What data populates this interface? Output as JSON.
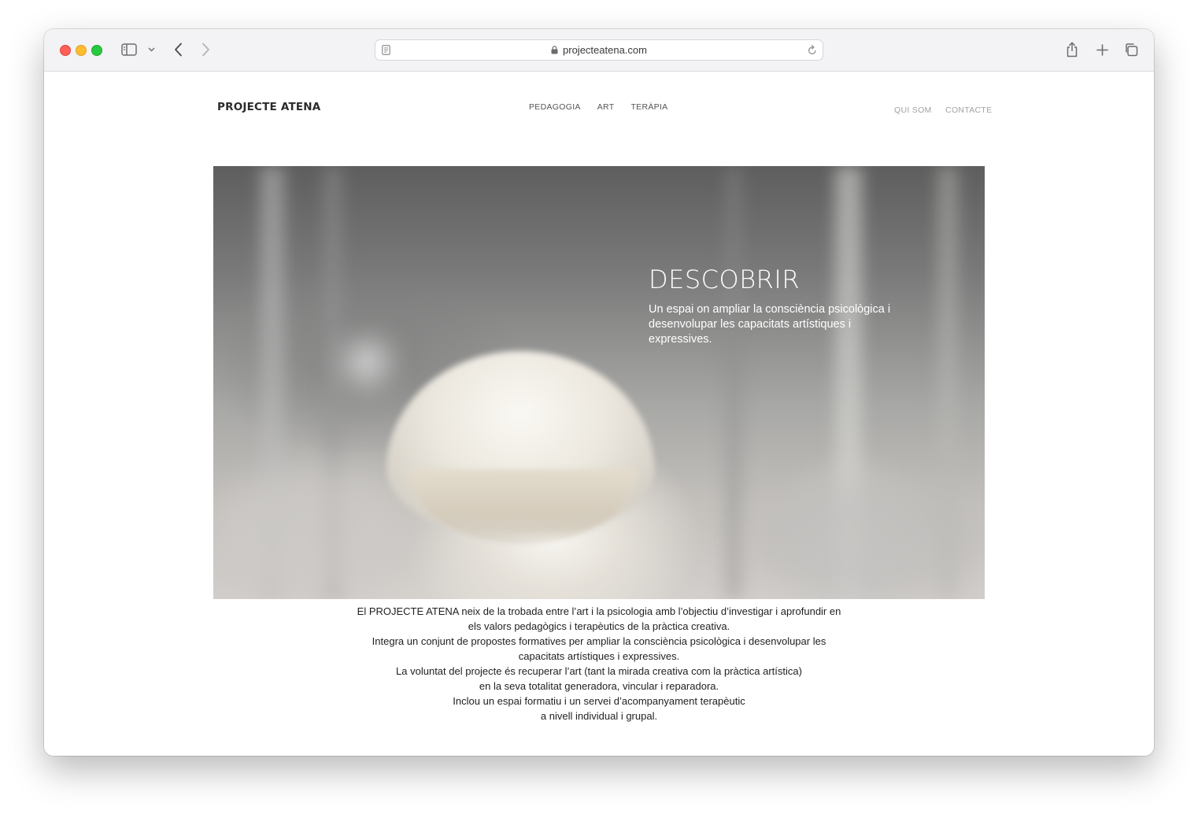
{
  "browser": {
    "url": "projecteatena.com",
    "icons": [
      "sidebar-icon",
      "chevron-down-icon",
      "back-icon",
      "forward-icon",
      "reader-icon",
      "lock-icon",
      "reload-icon",
      "share-icon",
      "new-tab-icon",
      "tabs-overview-icon"
    ]
  },
  "site": {
    "logo": "PROJECTE ATENA",
    "nav_center": [
      "PEDAGOGIA",
      "ART",
      "TERÀPIA"
    ],
    "nav_right": [
      "QUI SOM",
      "CONTACTE"
    ]
  },
  "hero": {
    "title": "DESCOBRIR",
    "subtitle_lines": [
      "Un espai on ampliar la consciència psicològica i",
      "desenvolupar les capacitats artístiques i",
      "expressives."
    ]
  },
  "about": {
    "lines": [
      "El PROJECTE ATENA neix de la trobada entre l’art i la psicologia amb l’objectiu d’investigar i aprofundir en",
      "els valors pedagògics i terapèutics de la pràctica creativa.",
      "Integra un conjunt de propostes formatives per ampliar la consciència psicològica i desenvolupar les",
      "capacitats artístiques i expressives.",
      "La voluntat del projecte és recuperar l’art (tant la mirada creativa com la pràctica artística)",
      "en la seva totalitat generadora, vincular i reparadora.",
      "Inclou un espai formatiu i un servei d’acompanyament terapèutic",
      "a nivell individual i grupal."
    ]
  },
  "colors": {
    "traffic_red": "#fe5f57",
    "traffic_yellow": "#febc2e",
    "traffic_green": "#28c840",
    "nav_muted": "#a2a2a2"
  }
}
